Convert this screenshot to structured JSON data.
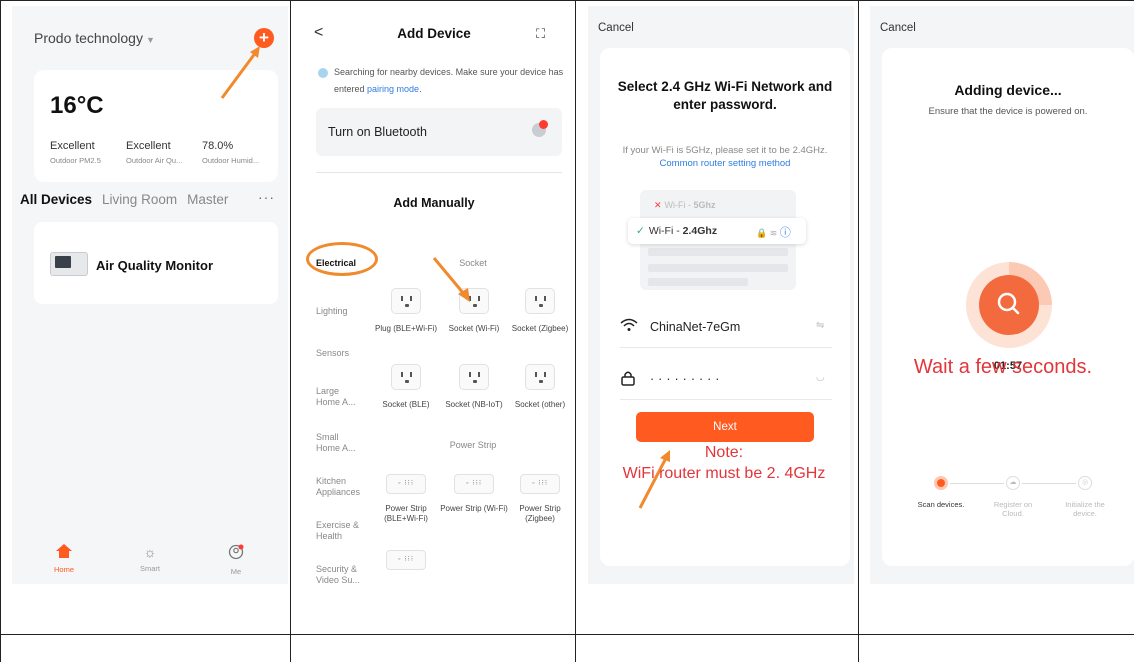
{
  "panel1": {
    "home_name": "Prodo technology",
    "add_icon": "plus-icon",
    "temperature": "16°C",
    "stats": [
      {
        "value": "Excellent",
        "label": "Outdoor PM2.5"
      },
      {
        "value": "Excellent",
        "label": "Outdoor Air Qu..."
      },
      {
        "value": "78.0%",
        "label": "Outdoor Humid..."
      }
    ],
    "tabs": [
      "All Devices",
      "Living Room",
      "Master"
    ],
    "more": "···",
    "device_name": "Air Quality Monitor",
    "nav": [
      "Home",
      "Smart",
      "Me"
    ],
    "accent": "#ff5a1f"
  },
  "panel2": {
    "title": "Add Device",
    "search_text": "Searching for nearby devices. Make sure your device has entered ",
    "search_link": "pairing mode",
    "search_end": ".",
    "bluetooth": "Turn on Bluetooth",
    "add_manually": "Add Manually",
    "categories": [
      "Electrical",
      "Lighting",
      "Sensors",
      "Large Home A...",
      "Small Home A...",
      "Kitchen Appliances",
      "Exercise & Health",
      "Security & Video Su..."
    ],
    "section_socket": "Socket",
    "section_strip": "Power Strip",
    "sockets": [
      "Plug (BLE+Wi-Fi)",
      "Socket (Wi-Fi)",
      "Socket (Zigbee)",
      "Socket (BLE)",
      "Socket (NB-IoT)",
      "Socket (other)"
    ],
    "strips": [
      "Power Strip (BLE+Wi-Fi)",
      "Power Strip (Wi-Fi)",
      "Power Strip (Zigbee)"
    ]
  },
  "panel3": {
    "cancel": "Cancel",
    "title": "Select 2.4 GHz Wi-Fi Network and enter password.",
    "hint": "If your Wi-Fi is 5GHz, please set it to be 2.4GHz. ",
    "hint_link": "Common router setting method",
    "wifi5_prefix": "Wi-Fi - ",
    "wifi5": "5Ghz",
    "wifi24_prefix": "Wi-Fi - ",
    "wifi24": "2.4Ghz",
    "ssid": "ChinaNet-7eGm",
    "password": "·········",
    "next": "Next",
    "note_title": "Note:",
    "note_body": "WiFi router must be 2. 4GHz"
  },
  "panel4": {
    "cancel": "Cancel",
    "title": "Adding device...",
    "subtitle": "Ensure that the device is powered on.",
    "timer": "01:57",
    "wait": "Wait a few seconds.",
    "steps": [
      "Scan devices.",
      "Register on Cloud.",
      "Initialize the device."
    ]
  }
}
